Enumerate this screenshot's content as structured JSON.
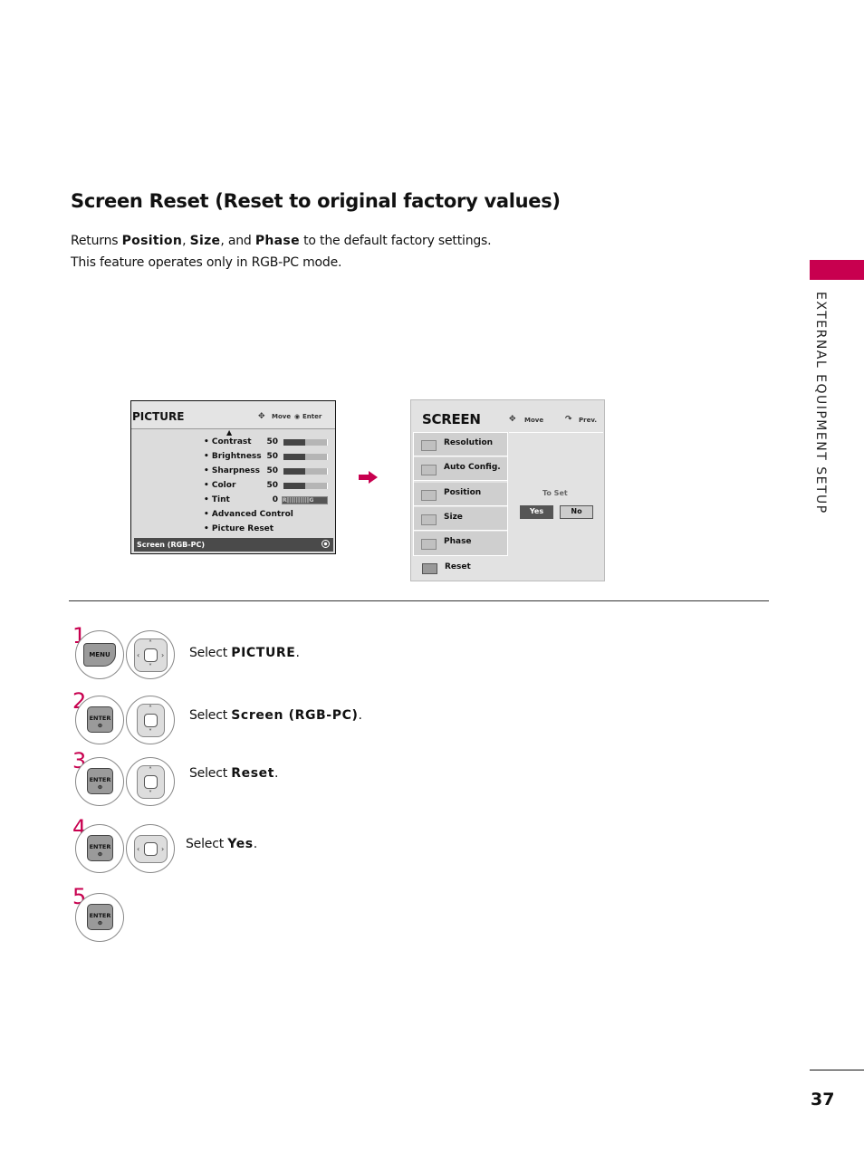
{
  "page": {
    "title": "Screen Reset (Reset to original factory values)",
    "intro_line1_prefix": "Returns ",
    "intro_b1": "Position",
    "intro_sep1": ", ",
    "intro_b2": "Size",
    "intro_sep2": ", and ",
    "intro_b3": "Phase",
    "intro_line1_suffix": " to the default factory settings.",
    "intro_line2": "This feature operates only in RGB-PC mode.",
    "side_label": "EXTERNAL EQUIPMENT SETUP",
    "page_number": "37",
    "accent_color": "#c8004f"
  },
  "picture_menu": {
    "title": "PICTURE",
    "hint_move": "Move",
    "hint_enter": "Enter",
    "items": [
      {
        "label": "• Contrast",
        "value": "50",
        "level": 0.5
      },
      {
        "label": "• Brightness",
        "value": "50",
        "level": 0.5
      },
      {
        "label": "• Sharpness",
        "value": "50",
        "level": 0.5
      },
      {
        "label": "• Color",
        "value": "50",
        "level": 0.5
      },
      {
        "label": "• Tint",
        "value": "0",
        "tint_bar": "R|||||||||||||||G"
      },
      {
        "label": "• Advanced Control"
      },
      {
        "label": "• Picture Reset"
      }
    ],
    "selected": "Screen (RGB-PC)"
  },
  "screen_menu": {
    "title": "SCREEN",
    "hint_move": "Move",
    "hint_prev": "Prev.",
    "items": [
      {
        "label": "Resolution",
        "icon": "resolution-icon"
      },
      {
        "label": "Auto Config.",
        "icon": "auto-config-icon"
      },
      {
        "label": "Position",
        "icon": "position-icon"
      },
      {
        "label": "Size",
        "icon": "size-icon"
      },
      {
        "label": "Phase",
        "icon": "phase-icon"
      }
    ],
    "reset_label": "Reset",
    "to_set": "To Set",
    "yes": "Yes",
    "no": "No"
  },
  "steps": [
    {
      "num": "1",
      "button": "MENU",
      "nav": "4-way",
      "prefix": "Select ",
      "target": "PICTURE",
      "suffix": "."
    },
    {
      "num": "2",
      "button": "ENTER",
      "nav": "up-down",
      "prefix": "Select ",
      "target": "Screen (RGB-PC)",
      "suffix": "."
    },
    {
      "num": "3",
      "button": "ENTER",
      "nav": "up-down",
      "prefix": "Select ",
      "target": "Reset",
      "suffix": "."
    },
    {
      "num": "4",
      "button": "ENTER",
      "nav": "left-right",
      "prefix": "Select ",
      "target": "Yes",
      "suffix": "."
    },
    {
      "num": "5",
      "button": "ENTER"
    }
  ]
}
